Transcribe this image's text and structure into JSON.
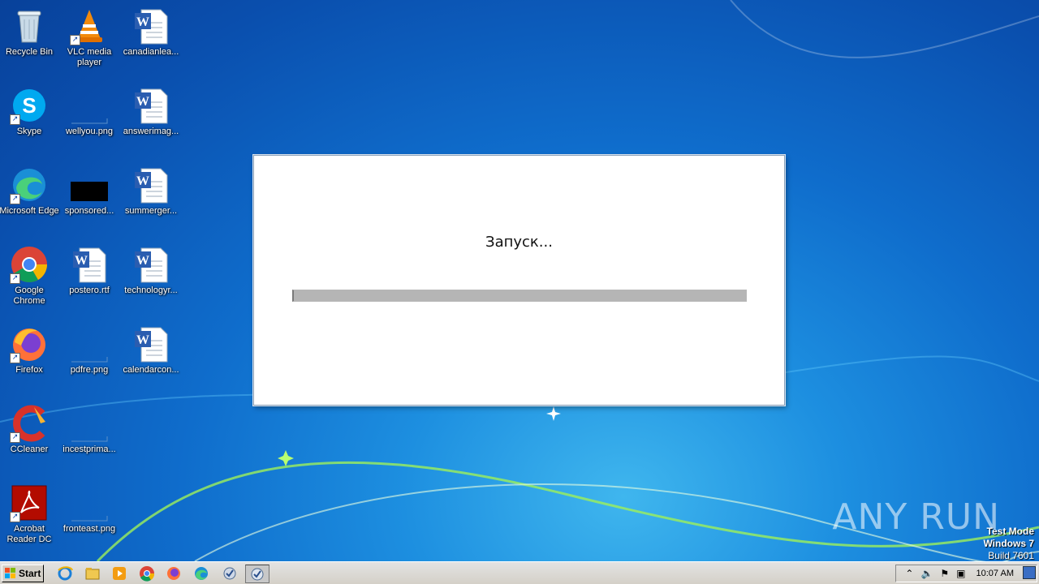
{
  "desktop": {
    "icons": [
      {
        "label": "Recycle Bin",
        "icon": "recycle-bin-icon"
      },
      {
        "label": "VLC media player",
        "icon": "vlc-icon"
      },
      {
        "label": "canadianlea...",
        "icon": "word-doc-icon"
      },
      {
        "label": "Skype",
        "icon": "skype-icon"
      },
      {
        "label": "wellyou.png",
        "icon": "png-file-icon"
      },
      {
        "label": "answerimag...",
        "icon": "word-doc-icon"
      },
      {
        "label": "Microsoft Edge",
        "icon": "edge-icon"
      },
      {
        "label": "sponsored...",
        "icon": "image-file-icon"
      },
      {
        "label": "summerger...",
        "icon": "word-doc-icon"
      },
      {
        "label": "Google Chrome",
        "icon": "chrome-icon"
      },
      {
        "label": "postero.rtf",
        "icon": "word-doc-icon"
      },
      {
        "label": "technologyr...",
        "icon": "word-doc-icon"
      },
      {
        "label": "Firefox",
        "icon": "firefox-icon"
      },
      {
        "label": "pdfre.png",
        "icon": "png-file-icon"
      },
      {
        "label": "calendarcon...",
        "icon": "word-doc-icon"
      },
      {
        "label": "CCleaner",
        "icon": "ccleaner-icon"
      },
      {
        "label": "incestprima...",
        "icon": "png-file-icon"
      },
      {
        "label": "Acrobat Reader DC",
        "icon": "acrobat-icon"
      },
      {
        "label": "fronteast.png",
        "icon": "png-file-icon"
      }
    ]
  },
  "dialog": {
    "title": "Запуск...",
    "progress_fraction": 1.0
  },
  "watermark": {
    "text": "ANY RUN"
  },
  "test_mode": {
    "line1": "Test Mode",
    "line2": "Windows 7",
    "line3": "Build 7601"
  },
  "taskbar": {
    "start_label": "Start",
    "clock": "10:07 AM"
  },
  "colors": {
    "desktop_blue": "#0f6dcc",
    "progress_fill": "#b5b5b5"
  }
}
